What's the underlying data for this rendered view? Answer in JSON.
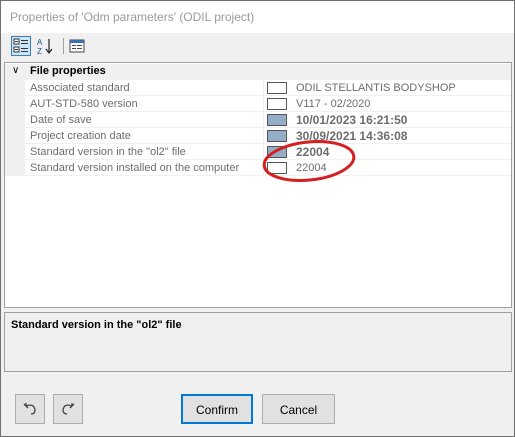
{
  "window": {
    "title": "Properties of 'Odm parameters' (ODIL project)"
  },
  "toolbar": {
    "categorized_icon": "categorized-view-icon",
    "alphabetical_icon": "alphabetical-sort-icon",
    "property_pages_icon": "property-pages-icon"
  },
  "grid": {
    "category": {
      "label": "File properties",
      "expanded": true
    },
    "rows": [
      {
        "name": "Associated standard",
        "value": "ODIL STELLANTIS BODYSHOP",
        "swatch": "#ffffff",
        "bold": false
      },
      {
        "name": "AUT-STD-580 version",
        "value": "V117 - 02/2020",
        "swatch": "#ffffff",
        "bold": false
      },
      {
        "name": "Date of save",
        "value": "10/01/2023 16:21:50",
        "swatch": "#94acc8",
        "bold": true
      },
      {
        "name": "Project creation date",
        "value": "30/09/2021 14:36:08",
        "swatch": "#94acc8",
        "bold": true
      },
      {
        "name": "Standard version in the \"ol2\" file",
        "value": "22004",
        "swatch": "#94acc8",
        "bold": true
      },
      {
        "name": "Standard version installed on the computer",
        "value": "22004",
        "swatch": "#ffffff",
        "bold": false
      }
    ]
  },
  "description": {
    "title": "Standard version in the \"ol2\" file"
  },
  "buttons": {
    "undo_icon": "undo-icon",
    "redo_icon": "redo-icon",
    "confirm": "Confirm",
    "cancel": "Cancel"
  },
  "colors": {
    "highlight_circle": "#d42020",
    "swatch_blue": "#94acc8"
  }
}
